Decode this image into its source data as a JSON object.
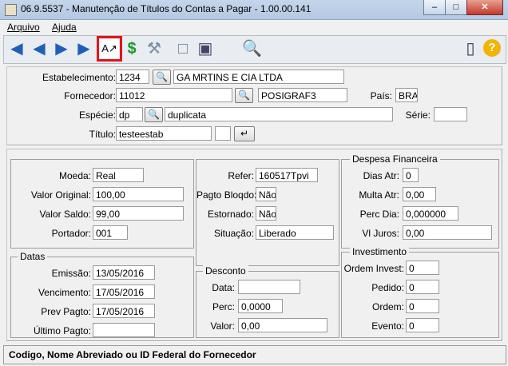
{
  "window": {
    "title": "06.9.5537 - Manutenção de Títulos do Contas a Pagar - 1.00.00.141"
  },
  "menu": {
    "file": "Arquivo",
    "help": "Ajuda"
  },
  "header": {
    "estabelecimento": {
      "label": "Estabelecimento:",
      "code": "1234",
      "name": "GA MRTINS E CIA LTDA"
    },
    "fornecedor": {
      "label": "Fornecedor:",
      "code": "11012",
      "short_name": "POSIGRAF3"
    },
    "pais": {
      "label": "País:",
      "value": "BRA"
    },
    "especie": {
      "label": "Espécie:",
      "code": "dp",
      "desc": "duplicata"
    },
    "serie": {
      "label": "Série:",
      "value": ""
    },
    "titulo": {
      "label": "Título:",
      "value": "testeestab",
      "parcela": ""
    }
  },
  "left": {
    "moeda": {
      "label": "Moeda:",
      "value": "Real"
    },
    "valor_original": {
      "label": "Valor Original:",
      "value": "100,00"
    },
    "valor_saldo": {
      "label": "Valor Saldo:",
      "value": "99,00"
    },
    "portador": {
      "label": "Portador:",
      "value": "001"
    }
  },
  "datas": {
    "title": "Datas",
    "emissao": {
      "label": "Emissão:",
      "value": "13/05/2016"
    },
    "vencimento": {
      "label": "Vencimento:",
      "value": "17/05/2016"
    },
    "prev_pagto": {
      "label": "Prev Pagto:",
      "value": "17/05/2016"
    },
    "ultimo_pagto": {
      "label": "Último Pagto:",
      "value": ""
    }
  },
  "middle": {
    "refer": {
      "label": "Refer:",
      "value": "160517Tpvi"
    },
    "pagto_bloqdo": {
      "label": "Pagto Bloqdo:",
      "value": "Não"
    },
    "estornado": {
      "label": "Estornado:",
      "value": "Não"
    },
    "situacao": {
      "label": "Situação:",
      "value": "Liberado"
    }
  },
  "desconto": {
    "title": "Desconto",
    "data": {
      "label": "Data:",
      "value": ""
    },
    "perc": {
      "label": "Perc:",
      "value": "0,0000"
    },
    "valor": {
      "label": "Valor:",
      "value": "0,00"
    }
  },
  "despesa": {
    "title": "Despesa Financeira",
    "dias_atr": {
      "label": "Dias Atr:",
      "value": "0"
    },
    "multa_atr": {
      "label": "Multa Atr:",
      "value": "0,00"
    },
    "perc_dia": {
      "label": "Perc Dia:",
      "value": "0,000000"
    },
    "vl_juros": {
      "label": "Vl Juros:",
      "value": "0,00"
    }
  },
  "investimento": {
    "title": "Investimento",
    "ordem_invest": {
      "label": "Ordem Invest:",
      "value": "0"
    },
    "pedido": {
      "label": "Pedido:",
      "value": "0"
    },
    "ordem": {
      "label": "Ordem:",
      "value": "0"
    },
    "evento": {
      "label": "Evento:",
      "value": "0"
    }
  },
  "status": {
    "text": "Codigo, Nome Abreviado ou ID Federal do Fornecedor"
  }
}
